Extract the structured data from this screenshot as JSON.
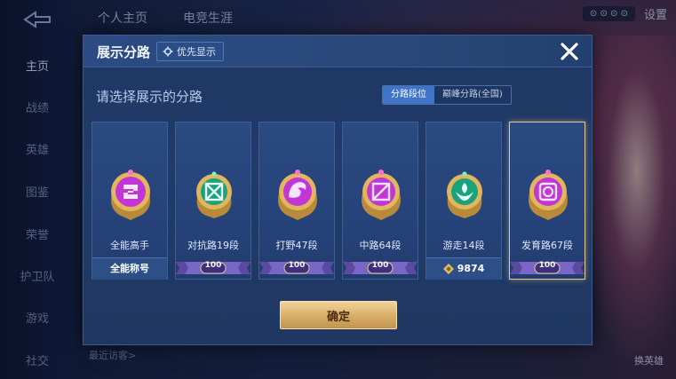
{
  "background": {
    "nav_items": [
      "主页",
      "战绩",
      "英雄",
      "图鉴",
      "荣誉",
      "护卫队",
      "游戏",
      "社交"
    ],
    "top_tabs": [
      "个人主页",
      "电竞生涯"
    ],
    "top_right_pill": "⊙ ⊙ ⊙ ⊙",
    "settings": "设置",
    "recent_visitors": "最近访客>",
    "bottom_right": "换英雄"
  },
  "modal": {
    "title": "展示分路",
    "priority_button": "优先显示",
    "subtitle": "请选择展示的分路",
    "toggle": {
      "options": [
        "分路段位",
        "巅峰分路(全国)"
      ],
      "active_index": 0
    },
    "cards": [
      {
        "label": "全能高手",
        "footer_type": "text",
        "footer": "全能称号",
        "emblem_color": "#c236d6",
        "selected": false
      },
      {
        "label": "对抗路19段",
        "footer_type": "ribbon",
        "footer": "100",
        "emblem_color": "#1aa27c",
        "selected": false
      },
      {
        "label": "打野47段",
        "footer_type": "ribbon",
        "footer": "100",
        "emblem_color": "#c236d6",
        "selected": false
      },
      {
        "label": "中路64段",
        "footer_type": "ribbon",
        "footer": "100",
        "emblem_color": "#c236d6",
        "selected": false
      },
      {
        "label": "游走14段",
        "footer_type": "coin",
        "footer": "9874",
        "emblem_color": "#1aa27c",
        "selected": false
      },
      {
        "label": "发育路67段",
        "footer_type": "ribbon",
        "footer": "100",
        "emblem_color": "#c236d6",
        "selected": true
      }
    ],
    "confirm_button": "确定"
  },
  "colors": {
    "accent_blue": "#3f74c8",
    "gold": "#e8c890",
    "purple": "#c236d6",
    "green": "#1aa27c"
  }
}
